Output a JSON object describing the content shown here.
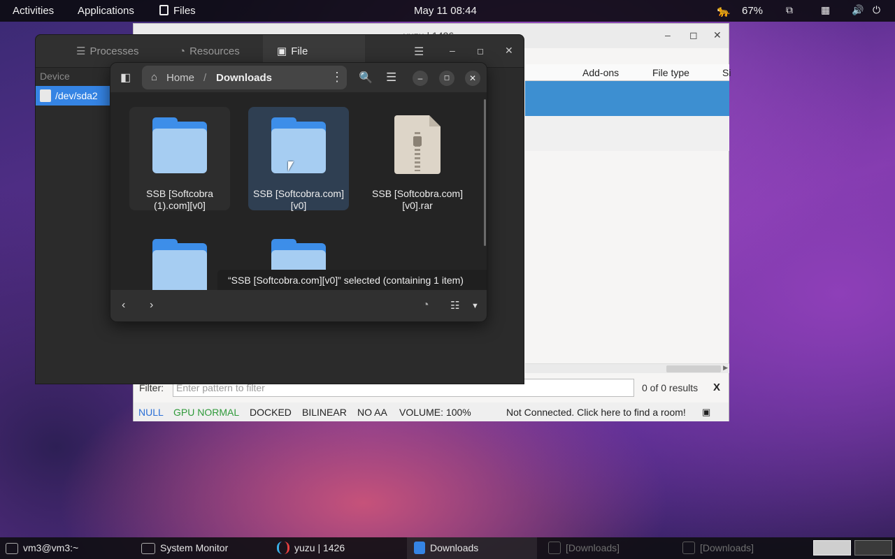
{
  "topbar": {
    "activities": "Activities",
    "applications": "Applications",
    "files_app": "Files",
    "clock": "May 11  08:44",
    "battery": "67%"
  },
  "yuzu": {
    "title": "yuzu | 1426",
    "columns": [
      "Add-ons",
      "File type",
      "Si"
    ],
    "filter_label": "Filter:",
    "filter_placeholder": "Enter pattern to filter",
    "results": "0 of 0 results",
    "clear": "X",
    "status": {
      "null": "NULL",
      "gpu": "GPU NORMAL",
      "docked": "DOCKED",
      "filter": "BILINEAR",
      "aa": "NO AA",
      "volume": "VOLUME: 100%",
      "room": "Not Connected. Click here to find a room!"
    },
    "colors": {
      "null": "#2a6fd6",
      "gpu": "#2f9a3a"
    }
  },
  "sysmon": {
    "tabs": [
      "Processes",
      "Resources",
      "File Systems"
    ],
    "device_header": "Device",
    "device": "/dev/sda2"
  },
  "files": {
    "path_home": "Home",
    "path_sep": "/",
    "path_current": "Downloads",
    "items": [
      {
        "name": "SSB [Softcobra (1).com][v0]"
      },
      {
        "name": "SSB [Softcobra.com][v0]"
      },
      {
        "name": "SSB [Softcobra.com][v0].rar"
      }
    ],
    "status_toast": "“SSB [Softcobra.com][v0]” selected  (containing 1 item)"
  },
  "taskbar": {
    "tasks": [
      "vm3@vm3:~",
      "System Monitor",
      "yuzu | 1426",
      "Downloads",
      "[Downloads]",
      "[Downloads]"
    ]
  },
  "accent": "#3584e4"
}
